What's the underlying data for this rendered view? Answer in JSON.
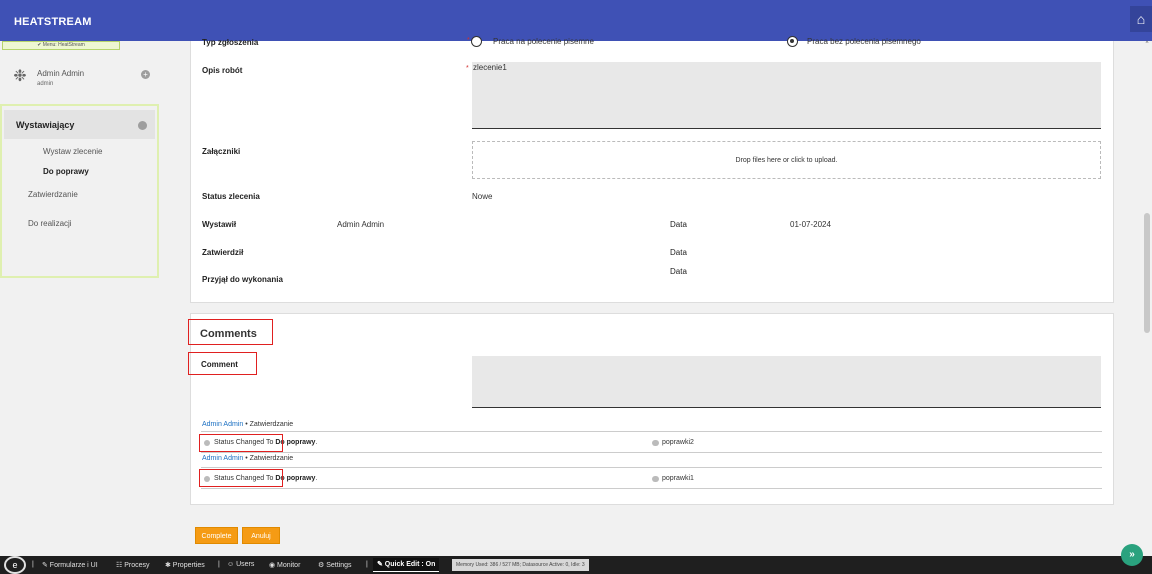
{
  "header": {
    "brand": "HEATSTREAM",
    "home_icon": "home-icon"
  },
  "sidebar": {
    "menu_tag": "✔ Menu: HeatStream",
    "user": {
      "name": "Admin Admin",
      "login": "admin",
      "plus": "+"
    },
    "active_item": "Wystawiający",
    "sub_items": [
      "Wystaw zlecenie",
      "Do poprawy"
    ],
    "items": [
      "Zatwierdzanie",
      "Do realizacji"
    ]
  },
  "form": {
    "typ_label": "Typ zgłoszenia",
    "typ_option1": "Praca na polecenie pisemne",
    "typ_option2": "Praca bez polecenia pisemnego",
    "opis_label": "Opis robót",
    "opis_value": "zlecenie1",
    "zalaczniki_label": "Załączniki",
    "dropzone_text": "Drop files here or click to upload.",
    "status_label": "Status zlecenia",
    "status_value": "Nowe",
    "wystawil_label": "Wystawił",
    "wystawil_value": "Admin Admin",
    "data_label": "Data",
    "data_value": "01-07-2024",
    "zatwierdzil_label": "Zatwierdził",
    "data2_label": "Data",
    "przyjal_label": "Przyjął do wykonania",
    "data3_label": "Data"
  },
  "comments": {
    "title": "Comments",
    "comment_label": "Comment",
    "entries": [
      {
        "author": "Admin Admin",
        "sep": " • ",
        "role": "Zatwierdzanie",
        "status_prefix": "Status Changed To ",
        "status_value": "Do poprawy",
        "period": ".",
        "text": "poprawki2"
      },
      {
        "author": "Admin Admin",
        "sep": " • ",
        "role": "Zatwierdzanie",
        "status_prefix": "Status Changed To ",
        "status_value": "Do poprawy",
        "period": ".",
        "text": "poprawki1"
      }
    ]
  },
  "buttons": {
    "complete": "Complete",
    "cancel": "Anuluj"
  },
  "bottombar": {
    "items": [
      "|",
      "✎ Formularze i UI",
      "☷ Procesy",
      "✱ Properties",
      "|",
      "☺ Users",
      "◉ Monitor",
      "⚙ Settings",
      "|"
    ],
    "quick_edit": "✎ Quick Edit : On",
    "memory": "Memory Used: 386 / 527 MB; Datasource Active: 0, Idle: 3",
    "expand": "»"
  }
}
